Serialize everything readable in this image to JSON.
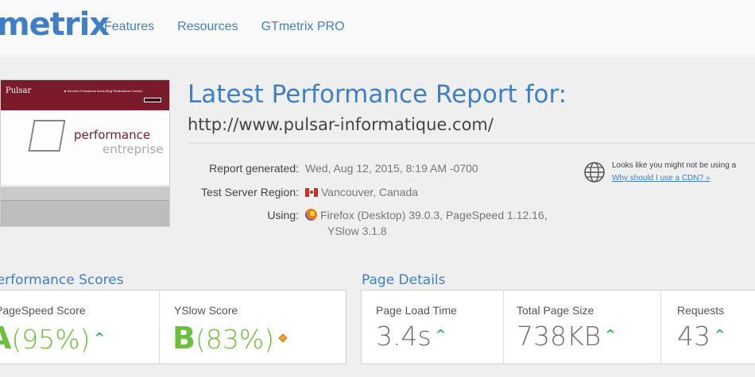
{
  "header": {
    "logo_text": "metrix",
    "nav": [
      "Features",
      "Resources",
      "GTmetrix PRO"
    ]
  },
  "thumbnail": {
    "brand": "Pulsar",
    "menu": "■ Services  Formations  Actus Blog  Réalisations  Contact",
    "tagline_1": "performance",
    "tagline_2": "entreprise"
  },
  "report": {
    "title": "Latest Performance Report for:",
    "url": "http://www.pulsar-informatique.com/",
    "generated_label": "Report generated:",
    "generated_value": "Wed, Aug 12, 2015, 8:19 AM -0700",
    "region_label": "Test Server Region:",
    "region_value": "Vancouver, Canada",
    "using_label": "Using:",
    "using_value_line1": "Firefox (Desktop) 39.0.3, PageSpeed 1.12.16,",
    "using_value_line2": "YSlow 3.1.8"
  },
  "cdn": {
    "notice": "Looks like you might not be using a",
    "link": "Why should I use a CDN? »"
  },
  "performance": {
    "title": "Performance Scores",
    "pagespeed_label": "PageSpeed Score",
    "pagespeed_grade": "A",
    "pagespeed_pct": "(95%)",
    "yslow_label": "YSlow Score",
    "yslow_grade": "B",
    "yslow_pct": "(83%)"
  },
  "details": {
    "title": "Page Details",
    "load_label": "Page Load Time",
    "load_value": "3.4s",
    "size_label": "Total Page Size",
    "size_value": "738KB",
    "req_label": "Requests",
    "req_value": "43"
  },
  "colors": {
    "accent": "#3f7fc6",
    "grade_green": "#6bbf3a",
    "arrow_green": "#3ab36b",
    "diamond_orange": "#f0a030"
  }
}
